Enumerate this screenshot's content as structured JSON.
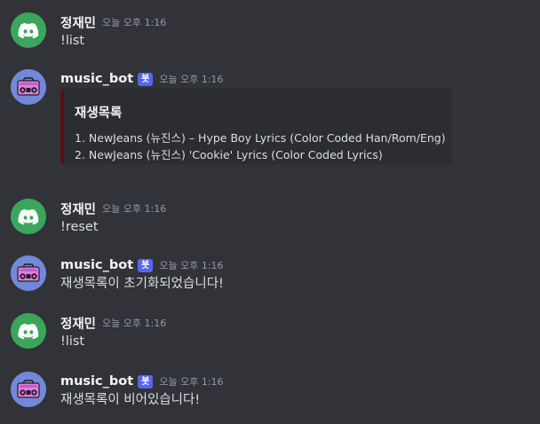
{
  "messages": [
    {
      "author": "정재민",
      "is_bot": false,
      "timestamp": "오늘 오후 1:16",
      "content": "!list"
    },
    {
      "author": "music_bot",
      "is_bot": true,
      "bot_tag": "봇",
      "timestamp": "오늘 오후 1:16",
      "embed": {
        "title": "재생목록",
        "lines": [
          "1. NewJeans (뉴진스) – Hype Boy Lyrics (Color Coded Han/Rom/Eng)",
          "2. NewJeans (뉴진스) 'Cookie' Lyrics (Color Coded Lyrics)"
        ],
        "accent_color": "#5c0d12"
      }
    },
    {
      "author": "정재민",
      "is_bot": false,
      "timestamp": "오늘 오후 1:16",
      "content": "!reset"
    },
    {
      "author": "music_bot",
      "is_bot": true,
      "bot_tag": "봇",
      "timestamp": "오늘 오후 1:16",
      "content": "재생목록이 초기화되었습니다!"
    },
    {
      "author": "정재민",
      "is_bot": false,
      "timestamp": "오늘 오후 1:16",
      "content": "!list"
    },
    {
      "author": "music_bot",
      "is_bot": true,
      "bot_tag": "봇",
      "timestamp": "오늘 오후 1:16",
      "content": "재생목록이 비어있습니다!"
    }
  ],
  "icons": {
    "user_avatar": "discord-logo-icon",
    "bot_avatar": "boombox-icon"
  },
  "colors": {
    "background": "#313338",
    "user_avatar_bg": "#3ba55d",
    "bot_avatar_bg": "#7289da",
    "bot_tag_bg": "#5865f2",
    "embed_bg": "#2b2d31"
  }
}
